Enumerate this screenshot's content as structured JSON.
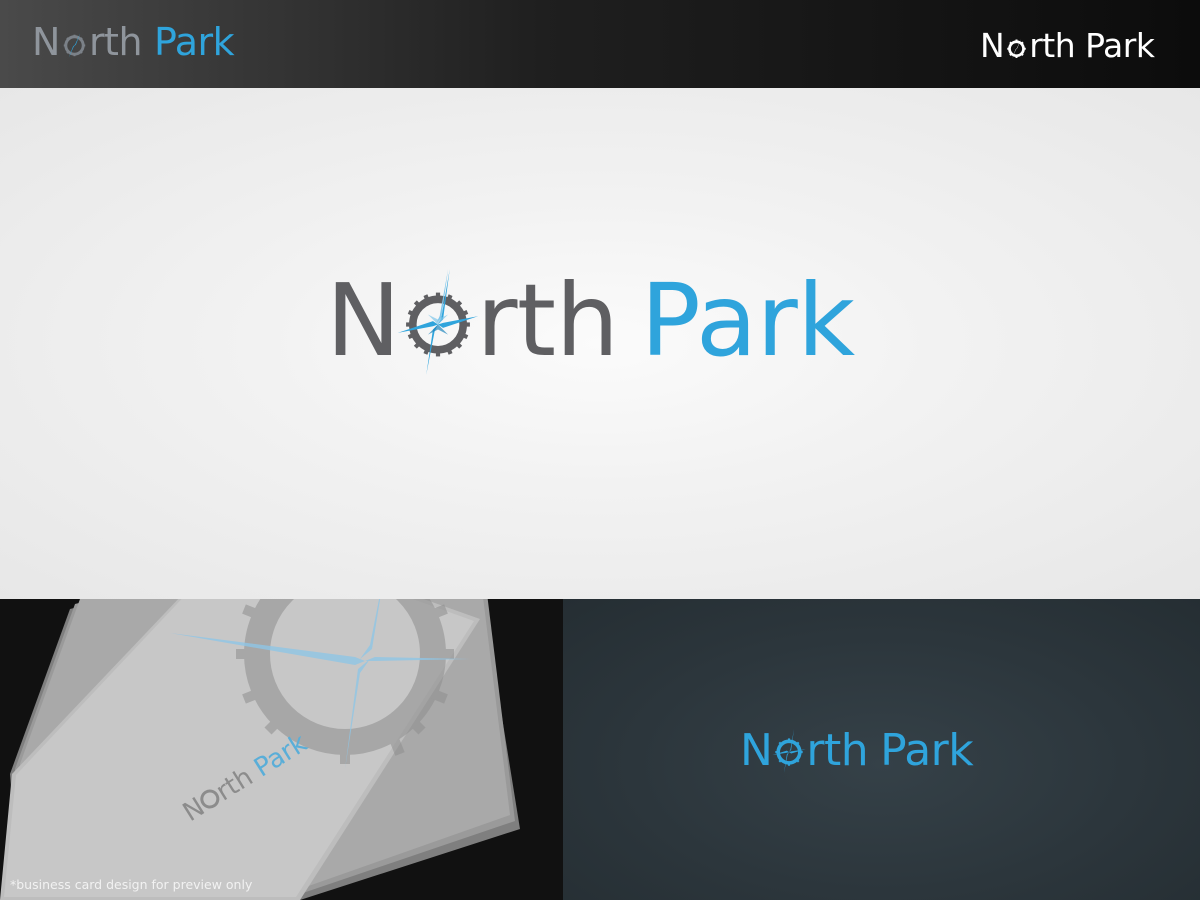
{
  "brand": {
    "word1": "N",
    "word1_rest": "rth",
    "word2": "Park",
    "colors": {
      "gray": "#5f5f62",
      "blue": "#2fa4dc",
      "white": "#ffffff",
      "dark_panel": "#2f3a40"
    },
    "emblem_icon": "compass-gear-icon"
  },
  "caption": "*business card design for preview only"
}
